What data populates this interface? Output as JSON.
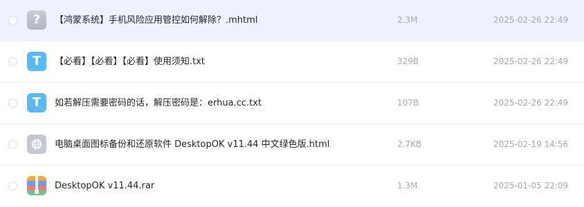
{
  "files": [
    {
      "name": "【鸿蒙系统】手机风险应用管控如何解除？.mhtml",
      "size": "2.3M",
      "date": "2025-02-26 22:49",
      "icon": "unknown-file-icon",
      "glyph": "?"
    },
    {
      "name": "【必看】【必看】【必看】使用须知.txt",
      "size": "329B",
      "date": "2025-02-26 22:49",
      "icon": "text-file-icon",
      "glyph": "T"
    },
    {
      "name": "如若解压需要密码的话，解压密码是：erhua.cc.txt",
      "size": "107B",
      "date": "2025-02-26 22:49",
      "icon": "text-file-icon",
      "glyph": "T"
    },
    {
      "name": "电脑桌面图标备份和还原软件 DesktopOK v11.44 中文绿色版.html",
      "size": "2.7KB",
      "date": "2025-02-19 14:56",
      "icon": "html-file-icon",
      "glyph": ""
    },
    {
      "name": "DesktopOK v11.44.rar",
      "size": "1.3M",
      "date": "2025-01-05 22:09",
      "icon": "archive-file-icon",
      "glyph": ""
    }
  ],
  "colors": {
    "hover_row": "#eef2fe",
    "text_icon": "#5cb8f2",
    "meta_text": "#a3a8b2"
  }
}
